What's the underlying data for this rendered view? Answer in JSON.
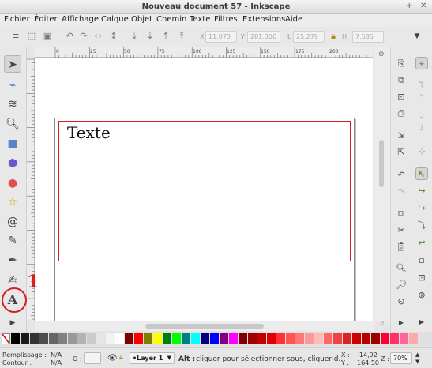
{
  "window": {
    "title": "Nouveau document 57 - Inkscape",
    "controls": [
      "–",
      "+",
      "✕"
    ]
  },
  "menu": [
    "Fichier",
    "Éditer",
    "Affichage",
    "Calque",
    "Objet",
    "Chemin",
    "Texte",
    "Filtres",
    "Extensions",
    "Aide"
  ],
  "controls": {
    "x_label": "X",
    "x_value": "11,073",
    "y_label": "Y",
    "y_value": "281,306",
    "w_label": "L",
    "w_value": "25,279",
    "h_label": "H",
    "h_value": "7,585"
  },
  "ruler_labels": [
    "0",
    "25",
    "50",
    "75",
    "100",
    "125",
    "150",
    "175",
    "200"
  ],
  "canvas": {
    "text_object": "Texte"
  },
  "annotation": {
    "number": "1"
  },
  "palette_colors": [
    "#000000",
    "#1a1a1a",
    "#333333",
    "#4d4d4d",
    "#666666",
    "#808080",
    "#999999",
    "#b3b3b3",
    "#cccccc",
    "#e6e6e6",
    "#f2f2f2",
    "#ffffff",
    "#800000",
    "#ff0000",
    "#808000",
    "#ffff00",
    "#008000",
    "#00ff00",
    "#008080",
    "#00ffff",
    "#000080",
    "#0000ff",
    "#800080",
    "#ff00ff",
    "#800000",
    "#a00000",
    "#c00000",
    "#e00000",
    "#ff3333",
    "#ff5555",
    "#ff7777",
    "#ff9999",
    "#ffbbbb",
    "#ff6666",
    "#ee4444",
    "#dd2222",
    "#cc0000",
    "#b30000",
    "#990000",
    "#ff0033",
    "#ff3366",
    "#ff6699",
    "#ffaaaa"
  ],
  "status": {
    "fill_label": "Remplissage :",
    "fill_value": "N/A",
    "stroke_label": "Contour :",
    "stroke_value": "N/A",
    "opacity_label": "O :",
    "layer": "•Layer 1",
    "message_bold": "Alt :",
    "message": "cliquer pour sélectionner sous, cliquer-d...",
    "x_label": "X :",
    "x_value": "-14,92",
    "y_label": "Y :",
    "y_value": "164,50",
    "zoom_label": "Z :",
    "zoom_value": "70%"
  }
}
